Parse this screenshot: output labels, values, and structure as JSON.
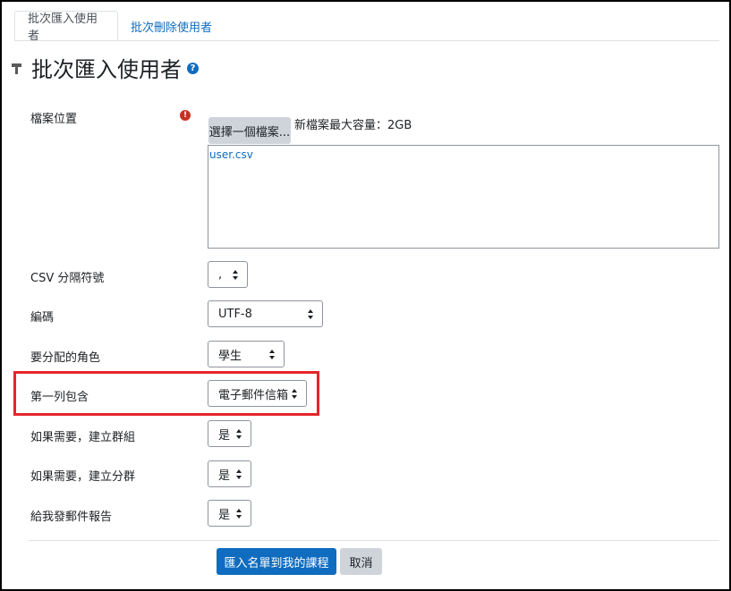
{
  "tabs": [
    {
      "label": "批次匯入使用者",
      "active": true
    },
    {
      "label": "批次刪除使用者",
      "active": false
    }
  ],
  "page": {
    "title": "批次匯入使用者",
    "help_icon": "question-circle-icon",
    "title_icon": "hammer-icon"
  },
  "form": {
    "file": {
      "label": "檔案位置",
      "required_icon": "exclamation-circle-icon",
      "choose_button": "選擇一個檔案...",
      "max_size": "新檔案最大容量：2GB",
      "filename": "user.csv"
    },
    "delimiter": {
      "label": "CSV 分隔符號",
      "value": ","
    },
    "encoding": {
      "label": "編碼",
      "value": "UTF-8"
    },
    "role": {
      "label": "要分配的角色",
      "value": "學生"
    },
    "first_column": {
      "label": "第一列包含",
      "value": "電子郵件信箱",
      "highlighted": true
    },
    "create_groups": {
      "label": "如果需要，建立群組",
      "value": "是"
    },
    "create_subgroups": {
      "label": "如果需要，建立分群",
      "value": "是"
    },
    "email_report": {
      "label": "給我發郵件報告",
      "value": "是"
    }
  },
  "actions": {
    "submit": "匯入名單到我的課程",
    "cancel": "取消"
  },
  "colors": {
    "primary": "#0f6cbf",
    "secondary_button": "#ced4da",
    "required": "#ca3120",
    "highlight_box": "#e5252a"
  }
}
